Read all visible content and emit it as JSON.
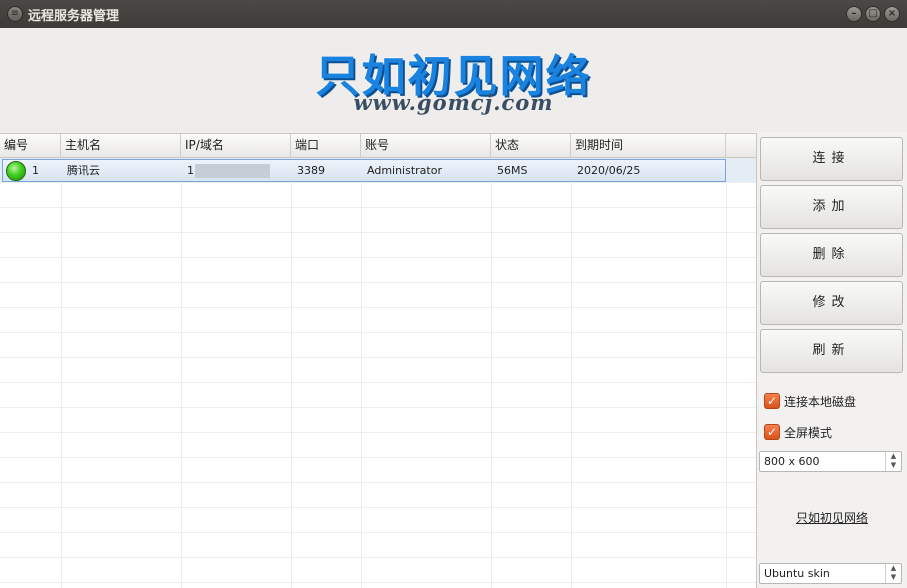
{
  "window": {
    "title": "远程服务器管理",
    "menu_icon": "menu-icon",
    "controls": [
      "minimize-icon",
      "maximize-icon",
      "close-icon"
    ]
  },
  "banner": {
    "logo_text": "只如初见网络",
    "logo_url": "www.gomcj.com",
    "logo_color": "#1a83e0"
  },
  "table": {
    "columns": [
      "编号",
      "主机名",
      "IP/域名",
      "端口",
      "账号",
      "状态",
      "到期时间"
    ],
    "rows": [
      {
        "status_icon": "online-status-icon",
        "id": "1",
        "hostname": "腾讯云",
        "ip": "1",
        "port": "3389",
        "account": "Administrator",
        "status": "56MS",
        "expire": "2020/06/25"
      }
    ]
  },
  "panel": {
    "buttons": [
      "连接",
      "添加",
      "删除",
      "修改",
      "刷新"
    ],
    "checkboxes": [
      {
        "label": "连接本地磁盘",
        "checked": true
      },
      {
        "label": "全屏模式",
        "checked": true
      }
    ],
    "resolution": "800 x 600",
    "link": "只如初见网络",
    "skin": "Ubuntu skin"
  },
  "colors": {
    "accent_checkbox": "#e0612a",
    "selection": "#d8e4f2",
    "titlebar": "#3c3b37"
  }
}
